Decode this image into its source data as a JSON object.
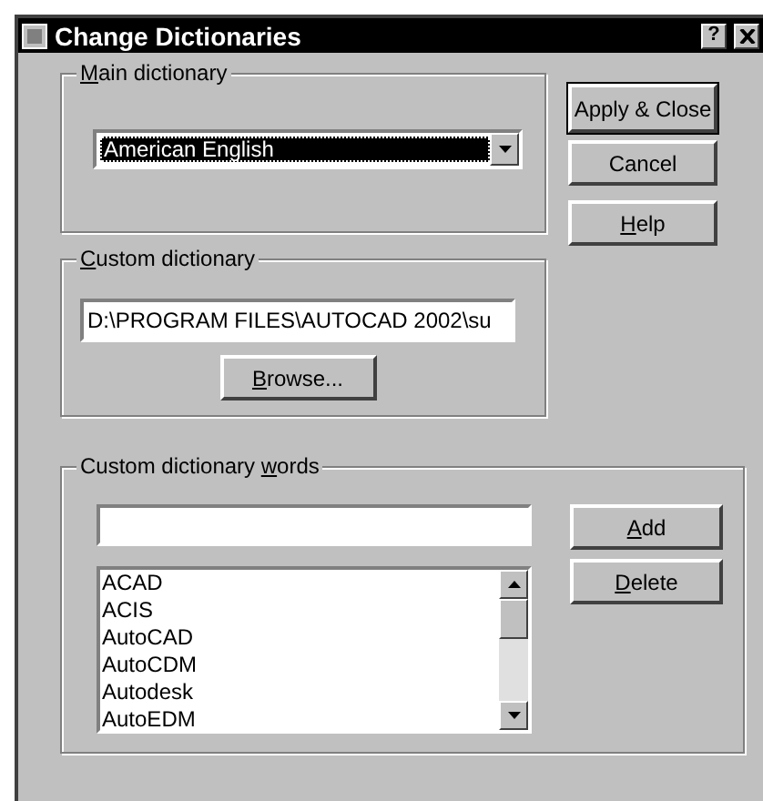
{
  "window": {
    "title": "Change Dictionaries",
    "title_buttons": [
      "?"
    ]
  },
  "main_dictionary": {
    "label": [
      {
        "text": "M",
        "underlined": true
      },
      {
        "text": "ain dictionary",
        "underlined": false
      }
    ],
    "value": "American English",
    "highlighted": true
  },
  "custom_dictionary": {
    "label": [
      {
        "text": "C",
        "underlined": true
      },
      {
        "text": "ustom dictionary",
        "underlined": false
      }
    ],
    "value": "D:\\PROGRAM FILES\\AUTOCAD 2002\\su",
    "browse_button": {
      "label": [
        {
          "text": "B",
          "underlined": true
        },
        {
          "text": "rowse...",
          "underlined": false
        }
      ]
    }
  },
  "side_buttons": [
    {
      "label": [
        {
          "text": "Apply & Close",
          "underlined": false
        }
      ],
      "default": true
    },
    {
      "label": [
        {
          "text": "Cancel",
          "underlined": false
        }
      ],
      "default": false
    },
    {
      "label": [
        {
          "text": "H",
          "underlined": true
        },
        {
          "text": "elp",
          "underlined": false
        }
      ],
      "default": false
    }
  ],
  "custom_words": {
    "label": [
      {
        "text": "Custom dictionary ",
        "underlined": false
      },
      {
        "text": "w",
        "underlined": true
      },
      {
        "text": "ords",
        "underlined": false
      }
    ],
    "items": [
      "ACAD",
      "ACIS",
      "AutoCAD",
      "AutoCDM",
      "Autodesk",
      "AutoEDM"
    ],
    "buttons": [
      {
        "label": [
          {
            "text": "A",
            "underlined": true
          },
          {
            "text": "dd",
            "underlined": false
          }
        ]
      },
      {
        "label": [
          {
            "text": "D",
            "underlined": true
          },
          {
            "text": "elete",
            "underlined": false
          }
        ]
      }
    ]
  }
}
